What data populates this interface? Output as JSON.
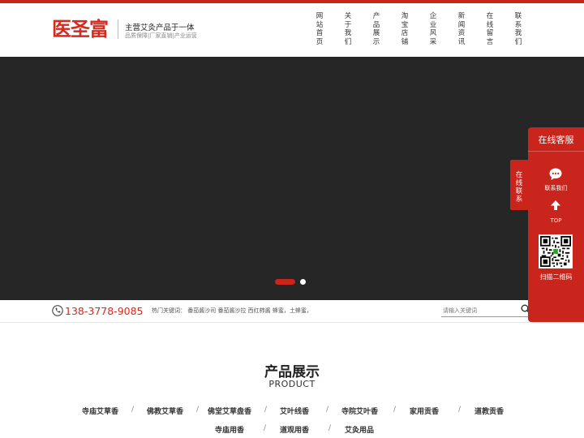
{
  "header": {
    "logo_text": "医圣富",
    "slogan": "主营艾灸产品于一体",
    "subslogan": "品质保障|厂家直销|产业运营",
    "brand_color": "#d42a1f",
    "nav": [
      "网站首页",
      "关于我们",
      "产品展示",
      "淘宝店铺",
      "企业风采",
      "新闻资讯",
      "在线留言",
      "联系我们"
    ]
  },
  "banner": {
    "slides": 2,
    "active_slide": 1
  },
  "searchbar": {
    "phone": "138-3778-9085",
    "hot_keywords": "热门关键词：  番茄酱沙司 番茄酱沙拉 西红柿酱 蜂蜜，土蜂蜜，",
    "search_placeholder": "请输入关键词"
  },
  "products": {
    "title": "产品展示",
    "subtitle": "PRODUCT",
    "categories_row1": [
      "寺庙艾草香",
      "佛教艾草香",
      "佛堂艾草盘香",
      "艾叶线香",
      "寺院艾叶香",
      "家用贡香",
      "道教贡香"
    ],
    "categories_row2": [
      "寺庙用香",
      "道观用香",
      "艾灸用品"
    ]
  },
  "side_service": {
    "title": "在线客服",
    "tab_label": "在线联系",
    "contact_label": "联系我们",
    "top_label": "TOP",
    "qr_label": "扫描二维码"
  }
}
